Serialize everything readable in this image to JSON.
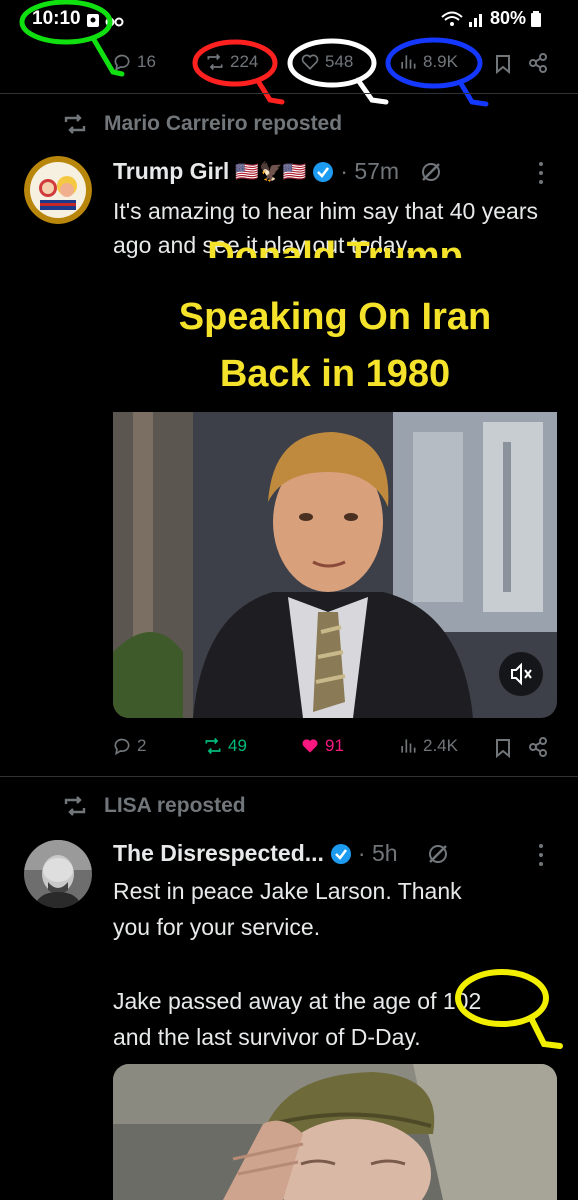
{
  "status_bar": {
    "time": "10:10",
    "battery": "80%"
  },
  "top_actions": {
    "replies": "16",
    "reposts": "224",
    "likes": "548",
    "views": "8.9K"
  },
  "posts": [
    {
      "repost_by": "Mario Carreiro reposted",
      "author": "Trump Girl",
      "author_flags": "🇺🇸🦅🇺🇸",
      "time": "· 57m",
      "text": "It's amazing to hear him say that 40 years ago and see it play out today.",
      "media": {
        "caption_cut": "Donald Trump",
        "caption_line1": "Speaking On Iran",
        "caption_line2": "Back in 1980"
      },
      "actions": {
        "replies": "2",
        "reposts": "49",
        "likes": "91",
        "views": "2.4K"
      }
    },
    {
      "repost_by": "LISA reposted",
      "author": "The Disrespected...",
      "time": "· 5h",
      "text_line1": "Rest in peace Jake Larson. Thank",
      "text_line2": "you for your service.",
      "text_line3": "Jake passed away at the age of 102",
      "text_line4": "and the last survivor of D-Day."
    }
  ],
  "colors": {
    "background": "#000000",
    "muted": "#71767b",
    "repost_green": "#00ba7c",
    "like_pink": "#f91880",
    "verified_blue": "#1d9bf0",
    "caption_yellow": "#f5e22a"
  }
}
